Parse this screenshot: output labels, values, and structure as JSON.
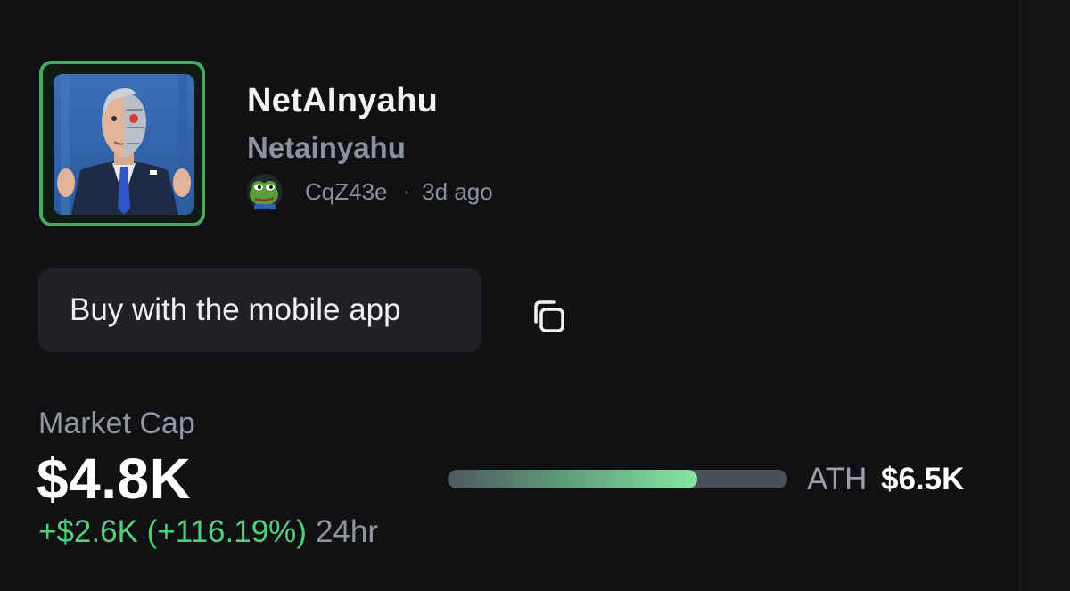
{
  "token": {
    "name": "NetAInyahu",
    "ticker": "Netainyahu",
    "creator": "CqZ43e",
    "separator": "·",
    "age": "3d ago",
    "avatar_icon": "token-avatar-image",
    "creator_icon": "pepe-avatar-icon"
  },
  "actions": {
    "buy_label": "Buy with the mobile app",
    "copy_icon": "copy-icon"
  },
  "market_cap": {
    "label": "Market Cap",
    "value": "$4.8K",
    "change": "+$2.6K (+116.19%)",
    "period": "24hr",
    "ath_label": "ATH",
    "ath_value": "$6.5K",
    "progress_to_ath_percent": 73.5
  },
  "colors": {
    "background": "#111114",
    "accent_green": "#4ed17a",
    "avatar_border": "#4aa865",
    "button_bg": "#202125",
    "muted_text": "#8d92a0"
  }
}
